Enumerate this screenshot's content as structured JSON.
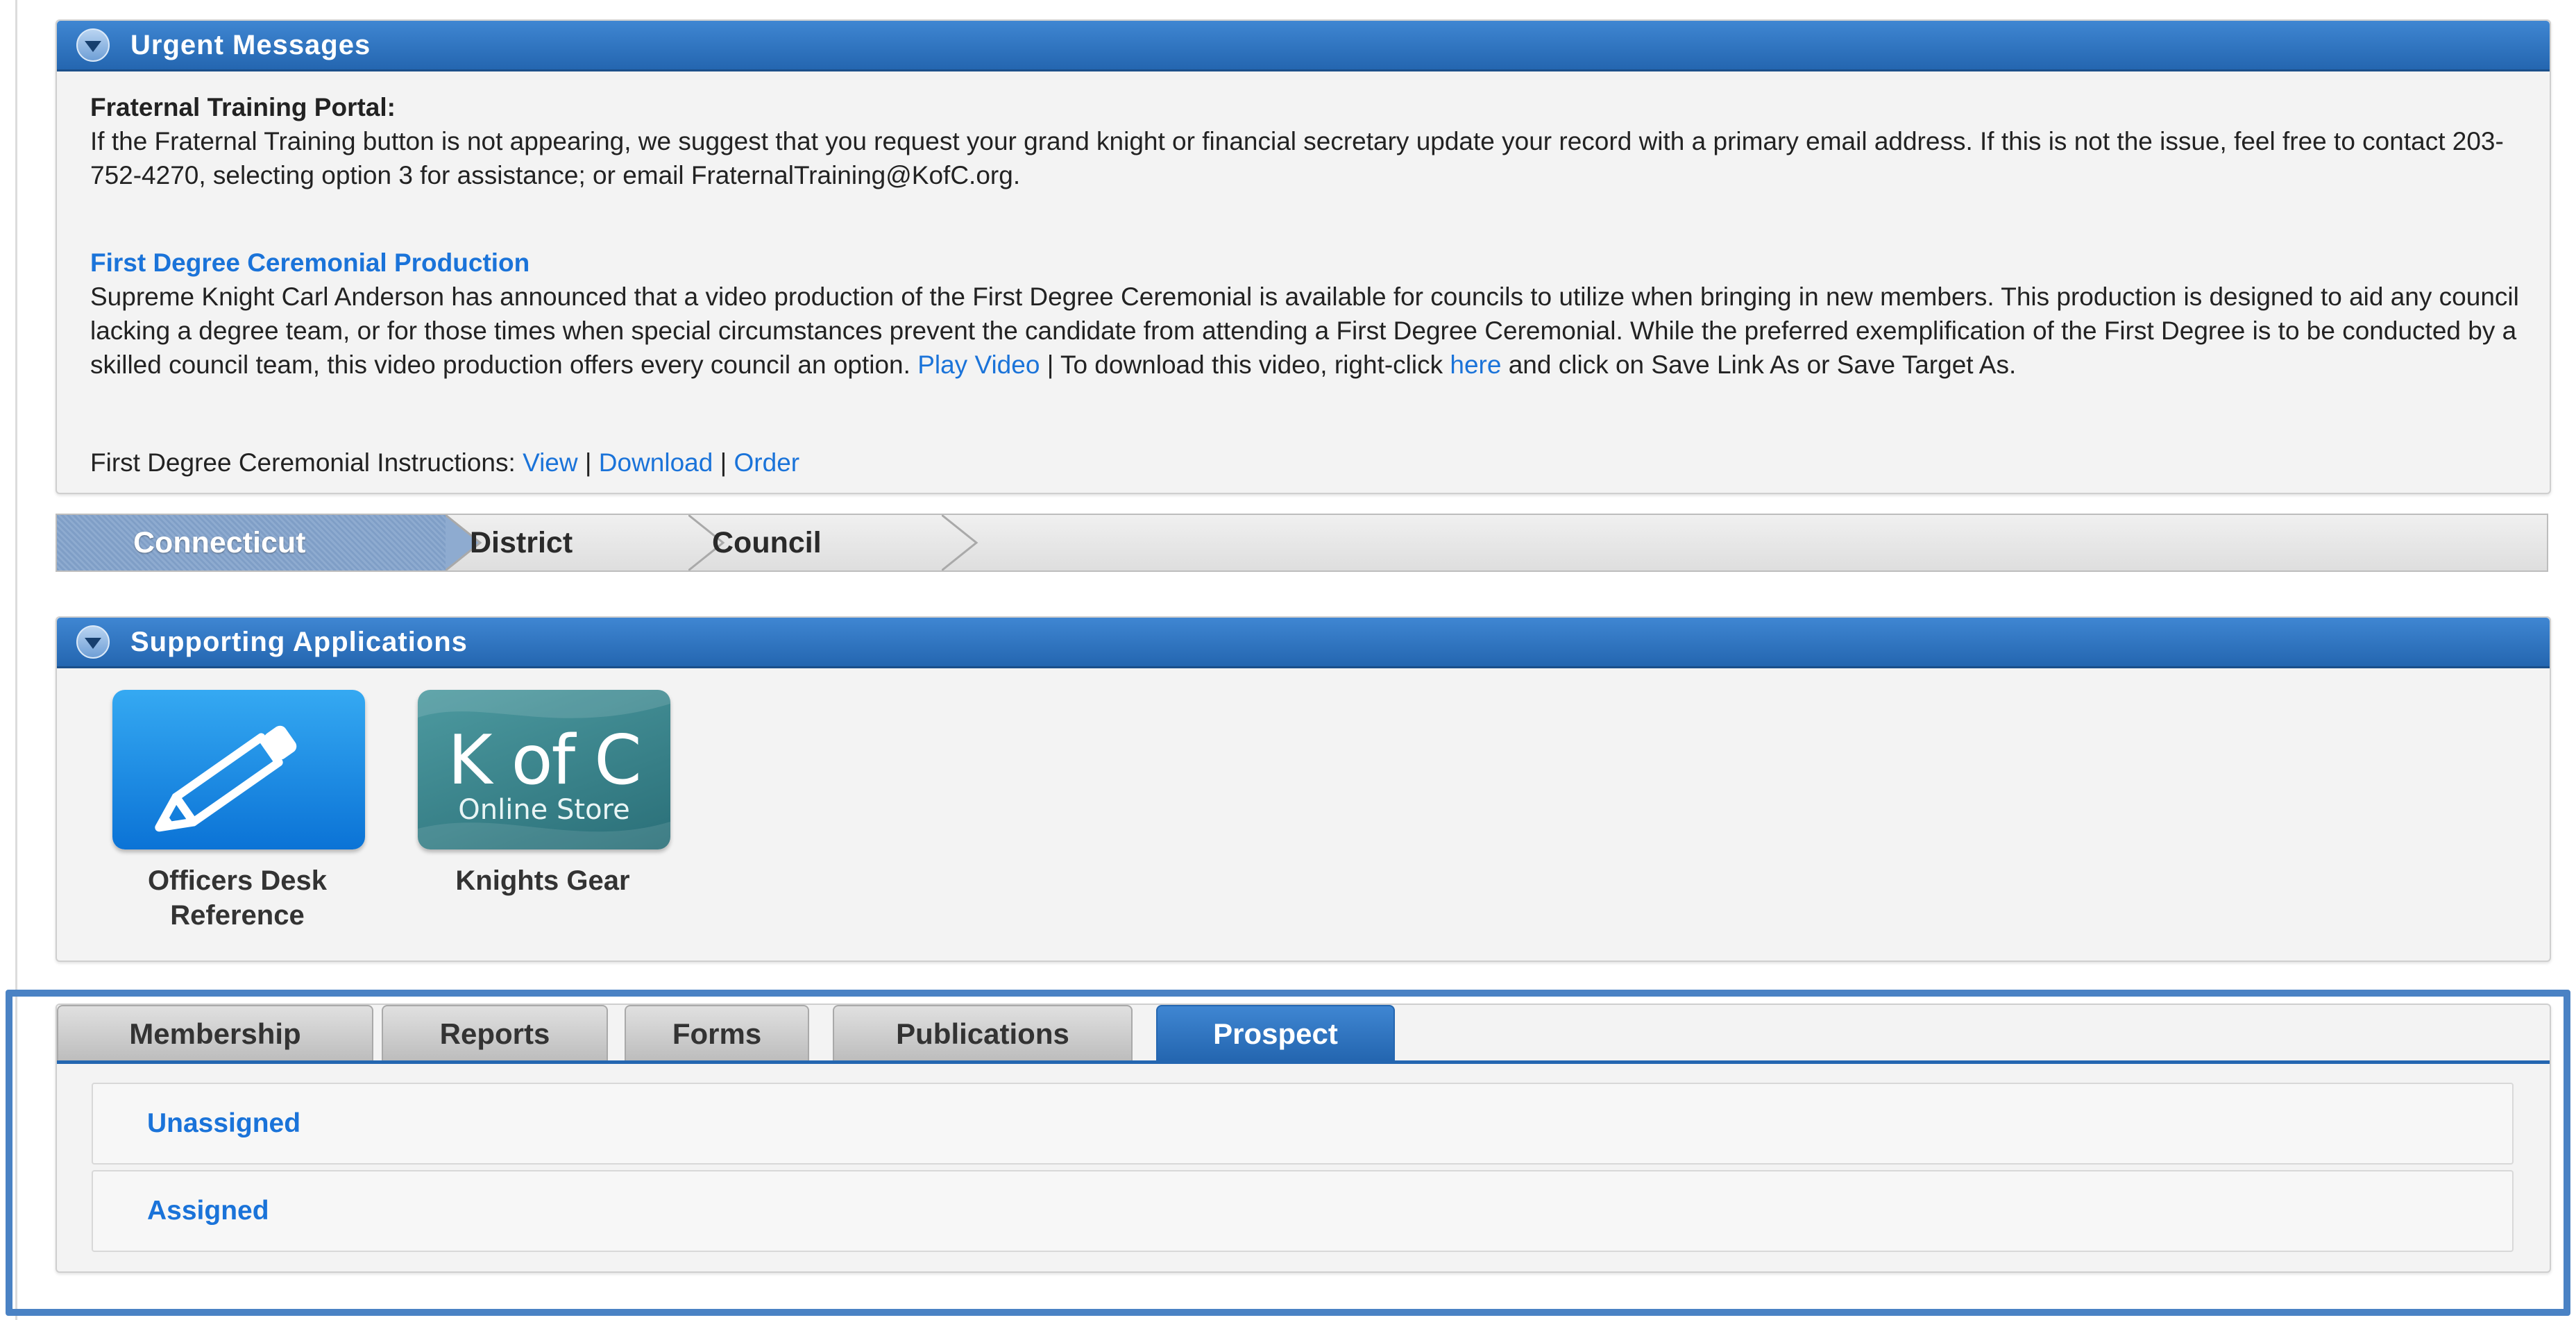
{
  "urgent": {
    "title": "Urgent Messages",
    "training_heading": "Fraternal Training Portal:",
    "training_text": "If the Fraternal Training button is not appearing, we suggest that you request your grand knight or financial secretary update your record with a primary email address. If this is not the issue, feel free to contact 203-752-4270, selecting option 3 for assistance; or email FraternalTraining@KofC.org.",
    "ceremonial_link": "First Degree Ceremonial Production",
    "ceremonial_text": "Supreme Knight Carl Anderson has announced that a video production of the First Degree Ceremonial is available for councils to utilize when bringing in new members. This production is designed to aid any council lacking a degree team, or for those times when special circumstances prevent the candidate from attending a First Degree Ceremonial. While the preferred exemplification of the First Degree is to be conducted by a skilled council team, this video production offers every council an option.",
    "play_video": "Play Video",
    "separator": "|",
    "download_prefix": "To download this video, right-click",
    "here": "here",
    "download_suffix": "and click on Save Link As or Save Target As.",
    "instructions_label": "First Degree Ceremonial Instructions:",
    "view": "View",
    "download": "Download",
    "order": "Order"
  },
  "breadcrumb": [
    "Connecticut",
    "District",
    "Council"
  ],
  "apps": {
    "title": "Supporting Applications",
    "items": [
      {
        "label": "Officers Desk Reference",
        "icon": "pencil-icon"
      },
      {
        "label": "Knights Gear",
        "icon": "kofc-online-store-logo",
        "logo_big": "K of C",
        "logo_small": "Online Store"
      }
    ]
  },
  "tabs": {
    "items": [
      "Membership",
      "Reports",
      "Forms",
      "Publications",
      "Prospect"
    ],
    "active": "Prospect",
    "rows": [
      "Unassigned",
      "Assigned"
    ]
  },
  "colors": {
    "header_blue": "#2466b0",
    "link_blue": "#1a73d9",
    "highlight_border": "#4a82c4"
  }
}
